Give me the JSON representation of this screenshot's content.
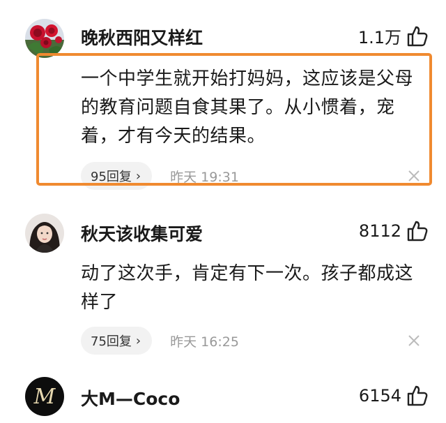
{
  "comments": [
    {
      "username": "晚秋西阳又样红",
      "likes": "1.1万",
      "text": "一个中学生就开始打妈妈，这应该是父母的教育问题自食其果了。从小惯着，宠着，才有今天的结果。",
      "replies": "95回复",
      "time": "昨天  19:31",
      "avatar_icon": "rose-flower-avatar"
    },
    {
      "username": "秋天该收集可爱",
      "likes": "8112",
      "text": "动了这次手，肯定有下一次。孩子都成这样了",
      "replies": "75回复",
      "time": "昨天  16:25",
      "avatar_icon": "girl-portrait-avatar"
    },
    {
      "username": "大M—Coco",
      "likes": "6154",
      "avatar_icon": "m-monogram-avatar"
    }
  ],
  "colors": {
    "highlight_border": "#f08a30",
    "reply_bg": "#f2f2f2",
    "timestamp": "#999999"
  },
  "icons": {
    "like": "thumbs-up-icon",
    "reply_chevron": "chevron-right-icon",
    "dismiss": "close-icon"
  }
}
